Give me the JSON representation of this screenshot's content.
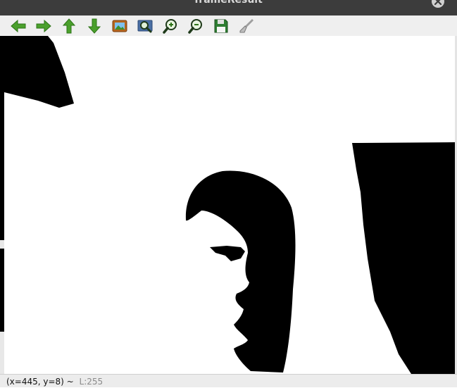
{
  "window": {
    "title": "frameResult"
  },
  "toolbar": {
    "buttons": [
      {
        "name": "pan-left",
        "icon": "arrow-left-icon"
      },
      {
        "name": "pan-right",
        "icon": "arrow-right-icon"
      },
      {
        "name": "pan-up",
        "icon": "arrow-up-icon"
      },
      {
        "name": "pan-down",
        "icon": "arrow-down-icon"
      },
      {
        "name": "zoom-original",
        "icon": "image-icon"
      },
      {
        "name": "zoom-fit",
        "icon": "zoom-fit-icon"
      },
      {
        "name": "zoom-in",
        "icon": "zoom-in-icon"
      },
      {
        "name": "zoom-out",
        "icon": "zoom-out-icon"
      },
      {
        "name": "save-image",
        "icon": "save-icon"
      },
      {
        "name": "properties",
        "icon": "brush-icon"
      }
    ]
  },
  "status": {
    "coords": "(x=445, y=8) ~",
    "level": "L:255"
  },
  "colors": {
    "arrow": "#4aa02c",
    "toolbar_bg": "#efefef",
    "titlebar_bg": "#3c3c3c"
  }
}
